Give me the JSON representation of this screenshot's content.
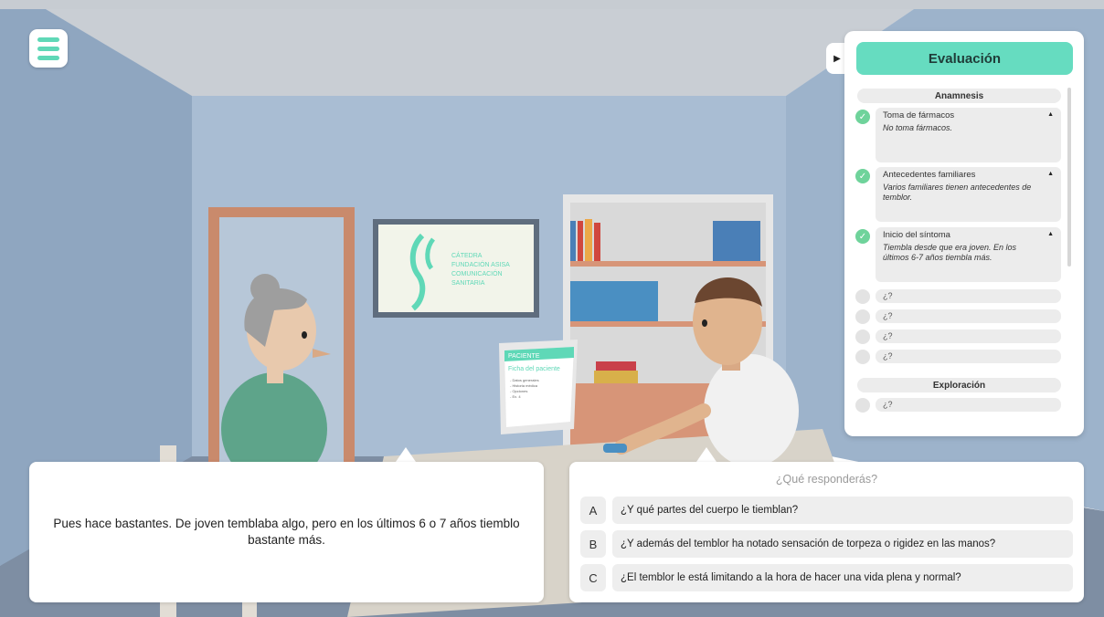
{
  "menu": {
    "icon": "hamburger-icon"
  },
  "evaluation": {
    "title": "Evaluación",
    "toggle_icon": "play-triangle-icon",
    "sections": [
      {
        "title": "Anamnesis",
        "items": [
          {
            "title": "Toma de fármacos",
            "text": "No toma fármacos.",
            "done": true
          },
          {
            "title": "Antecedentes familiares",
            "text": "Varios familiares tienen antecedentes de temblor.",
            "done": true
          },
          {
            "title": "Inicio del síntoma",
            "text": "Tiembla desde que era joven. En los últimos 6-7 años tiembla más.",
            "done": true
          },
          {
            "title": "¿?",
            "done": false
          },
          {
            "title": "¿?",
            "done": false
          },
          {
            "title": "¿?",
            "done": false
          },
          {
            "title": "¿?",
            "done": false
          }
        ]
      },
      {
        "title": "Exploración",
        "items": [
          {
            "title": "¿?",
            "done": false
          }
        ]
      }
    ]
  },
  "scene": {
    "poster": {
      "line1": "CÁTEDRA",
      "line2": "FUNDACIÓN ASISA",
      "line3": "COMUNICACIÓN",
      "line4": "SANITARIA"
    },
    "monitor": {
      "header": "PACIENTE",
      "title": "Ficha del paciente",
      "items": [
        "- Datos generales",
        "- Historia médica",
        "- Opciones",
        "- Ex. 4"
      ]
    },
    "colors": {
      "wall": "#9fb4cc",
      "accent": "#66dcc0"
    }
  },
  "dialogue": {
    "text": "Pues hace bastantes.  De joven temblaba algo, pero en los últimos 6 o 7 años tiemblo bastante más."
  },
  "responses": {
    "prompt": "¿Qué responderás?",
    "options": [
      {
        "letter": "A",
        "text": "¿Y qué partes del cuerpo le tiemblan?"
      },
      {
        "letter": "B",
        "text": "¿Y además del temblor ha notado sensación de torpeza o rigidez en las manos?"
      },
      {
        "letter": "C",
        "text": "¿El temblor le está limitando a la hora de hacer una vida plena y normal?"
      }
    ]
  }
}
